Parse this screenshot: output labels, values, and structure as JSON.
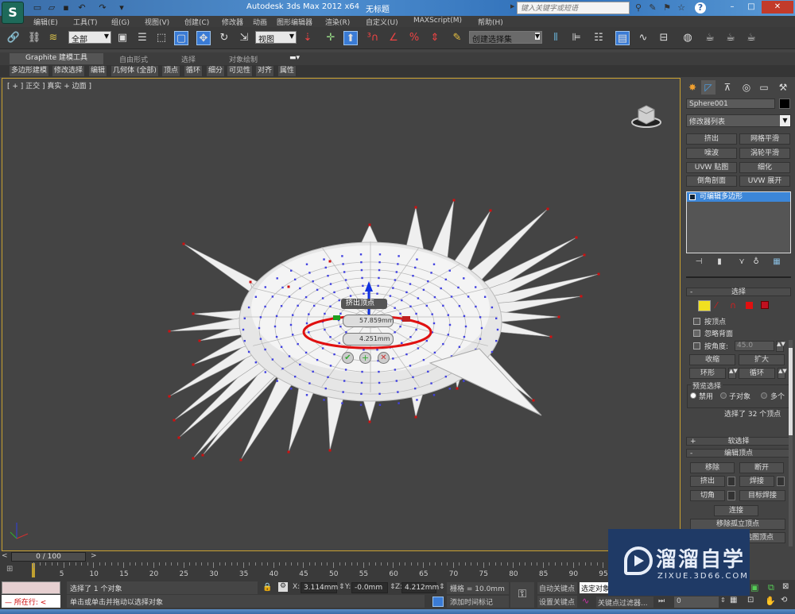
{
  "titlebar": {
    "app_title": "Autodesk 3ds Max  2012 x64",
    "doc_title": "无标题",
    "search_placeholder": "键入关键字或短语",
    "quick_access": [
      "new-icon",
      "open-icon",
      "save-icon",
      "undo-icon",
      "redo-icon",
      "customize-icon"
    ],
    "window_buttons": {
      "minimize": "–",
      "maximize": "□",
      "close": "✕"
    }
  },
  "menu": [
    "编辑(E)",
    "工具(T)",
    "组(G)",
    "视图(V)",
    "创建(C)",
    "修改器",
    "动画",
    "图形编辑器",
    "渲染(R)",
    "自定义(U)",
    "MAXScript(M)",
    "帮助(H)"
  ],
  "toolbar": {
    "selection_filter": "全部",
    "reference_coord": "视图",
    "named_selection": "创建选择集",
    "snaps": [
      "3",
      "∠",
      "%",
      "⇕"
    ]
  },
  "ribbon": {
    "tabs": [
      "Graphite 建模工具",
      "自由形式",
      "选择",
      "对象绘制"
    ],
    "panels": [
      "多边形建模",
      "修改选择",
      "编辑",
      "几何体 (全部)",
      "顶点",
      "循环",
      "细分",
      "可见性",
      "对齐",
      "属性"
    ]
  },
  "viewport": {
    "label": "[ + ] 正交 ] 真实 + 边面 ]",
    "caddy": {
      "title": "挤出顶点",
      "height_value": "57.859mm",
      "width_value": "4.251mm",
      "buttons": [
        "ok",
        "apply-continue",
        "cancel"
      ]
    }
  },
  "command_panel": {
    "object_name": "Sphere001",
    "object_color": "#000000",
    "modifier_list": "修改器列表",
    "modifier_buttons": [
      "挤出",
      "网格平滑",
      "噪波",
      "涡轮平滑",
      "UVW 贴图",
      "细化",
      "倒角剖面",
      "UVW 展开"
    ],
    "stack": [
      "可编辑多边形"
    ],
    "selection": {
      "title": "选择",
      "by_vertex": "按顶点",
      "ignore_backfacing": "忽略背面",
      "by_angle": "按角度:",
      "angle_value": "45.0",
      "shrink": "收缩",
      "grow": "扩大",
      "ring": "环形",
      "loop": "循环",
      "preview_title": "预览选择",
      "preview_options": [
        "禁用",
        "子对象",
        "多个"
      ],
      "preview_selected": "禁用",
      "status": "选择了 32 个顶点"
    },
    "soft_selection": "软选择",
    "edit_vertices": {
      "title": "编辑顶点",
      "buttons": [
        "移除",
        "断开",
        "挤出",
        "焊接",
        "切角",
        "目标焊接",
        "连接",
        "移除孤立顶点",
        "移除未使用的贴图顶点"
      ]
    }
  },
  "timeline": {
    "frame": "0 / 100",
    "ticks": [
      0,
      5,
      10,
      15,
      20,
      25,
      30,
      35,
      40,
      45,
      50,
      55,
      60,
      65,
      70,
      75,
      80,
      85,
      90,
      95,
      100
    ]
  },
  "status": {
    "maxscript_line": "— 所在行: <",
    "selection_msg": "选择了 1 个对象",
    "prompt": "单击或单击并拖动以选择对象",
    "x": "3.114mm",
    "y": "-0.0mm",
    "z": "4.212mm",
    "grid": "栅格 = 10.0mm",
    "add_time_tag": "添加时间标记",
    "auto_key": "自动关键点",
    "set_key": "设置关键点",
    "key_mode": "选定对象",
    "key_filters": "关键点过滤器...",
    "current_frame": "0"
  },
  "watermark": {
    "brand": "溜溜自学",
    "url": "ZIXUE.3D66.COM"
  }
}
